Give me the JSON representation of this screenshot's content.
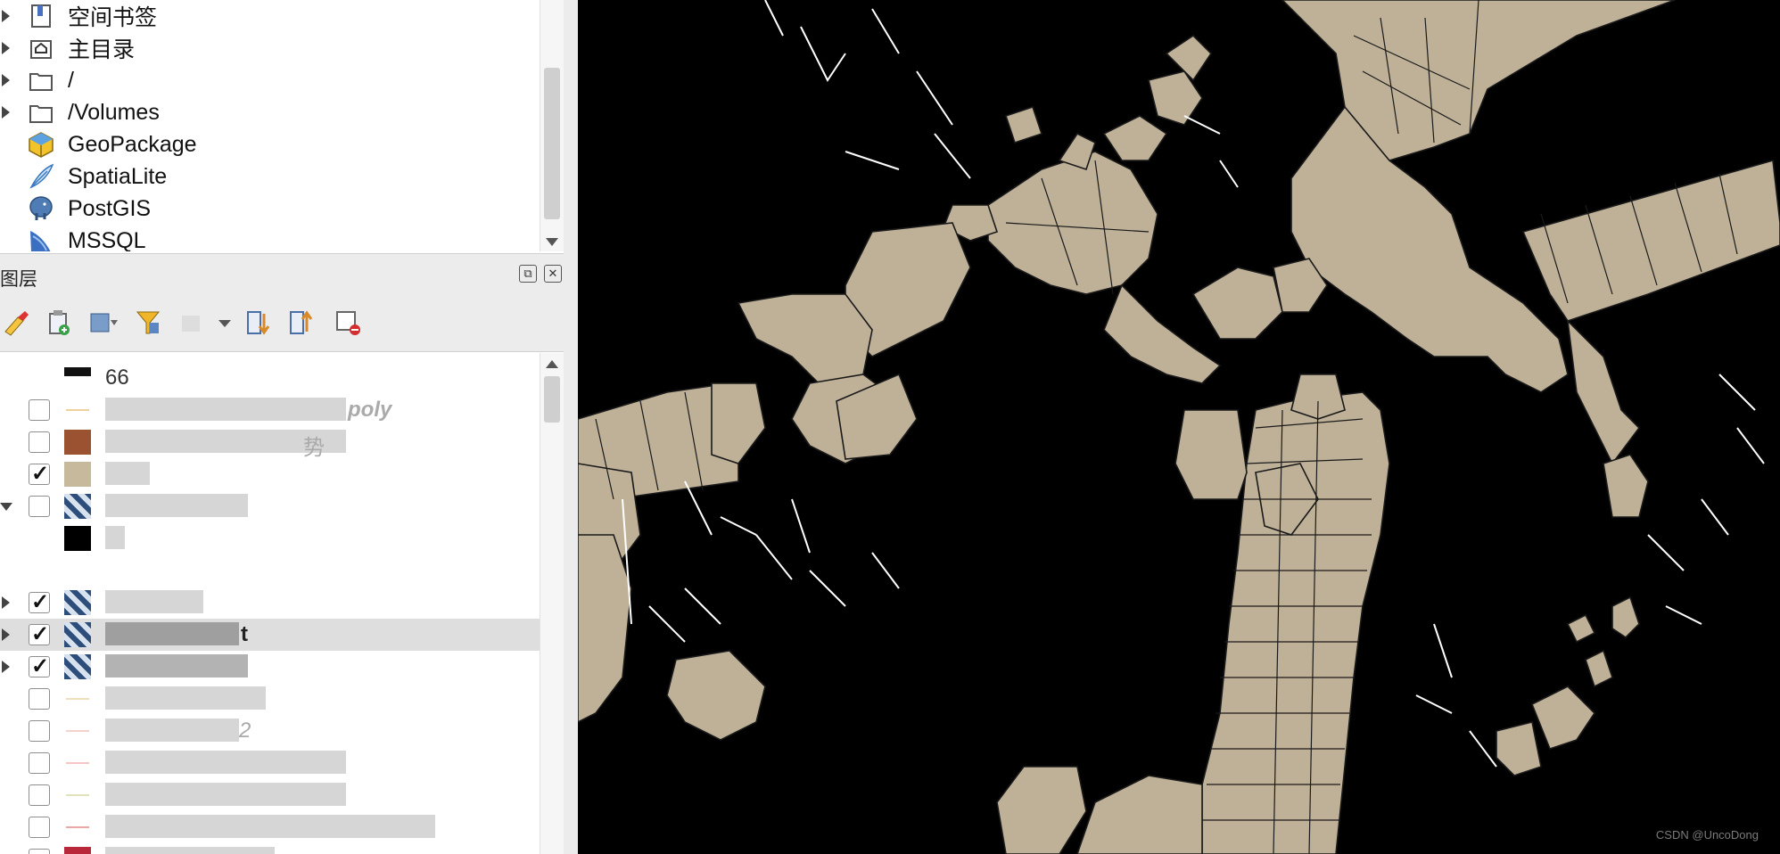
{
  "browser": {
    "items": [
      {
        "label": "空间书签",
        "icon": "bookmark-icon",
        "expandable": true
      },
      {
        "label": "主目录",
        "icon": "home-folder-icon",
        "expandable": true
      },
      {
        "label": "/",
        "icon": "folder-icon",
        "expandable": true
      },
      {
        "label": "/Volumes",
        "icon": "folder-icon",
        "expandable": true
      },
      {
        "label": "GeoPackage",
        "icon": "geopackage-icon",
        "expandable": false
      },
      {
        "label": "SpatiaLite",
        "icon": "spatialite-icon",
        "expandable": false
      },
      {
        "label": "PostGIS",
        "icon": "postgis-elephant-icon",
        "expandable": false
      },
      {
        "label": "MSSQL",
        "icon": "mssql-icon",
        "expandable": false
      }
    ]
  },
  "layers_panel": {
    "title": "图层",
    "toolbar_icons": [
      "open-layer-styling-icon",
      "add-group-icon",
      "manage-map-themes-icon",
      "filter-legend-icon",
      "expand-all-icon",
      "collapse-all-icon",
      "remove-layer-icon"
    ],
    "rows": [
      {
        "label": "66",
        "checked": null,
        "expanded": false
      },
      {
        "label": "poly",
        "checked": false,
        "expanded": false
      },
      {
        "label": "势",
        "checked": false,
        "expanded": false
      },
      {
        "label": "",
        "checked": true,
        "expanded": false
      },
      {
        "label": "",
        "checked": false,
        "expanded": true
      },
      {
        "label": "",
        "checked": null,
        "expanded": false
      },
      {
        "label": "",
        "checked": null,
        "expanded": false
      },
      {
        "label": "",
        "checked": true,
        "expanded": false
      },
      {
        "label": "t",
        "checked": true,
        "expanded": false,
        "selected": true
      },
      {
        "label": "",
        "checked": true,
        "expanded": false
      },
      {
        "label": "",
        "checked": false,
        "expanded": false
      },
      {
        "label": "2",
        "checked": false,
        "expanded": false
      },
      {
        "label": "",
        "checked": false,
        "expanded": false
      },
      {
        "label": "",
        "checked": false,
        "expanded": false
      },
      {
        "label": "",
        "checked": false,
        "expanded": false
      },
      {
        "label": "",
        "checked": false,
        "expanded": false
      }
    ]
  },
  "map": {
    "background_color": "#000000",
    "polygon_fill": "#bfb198",
    "polygon_stroke": "#1a1a1a",
    "line_color": "#ffffff"
  },
  "watermark": "CSDN @UncoDong"
}
